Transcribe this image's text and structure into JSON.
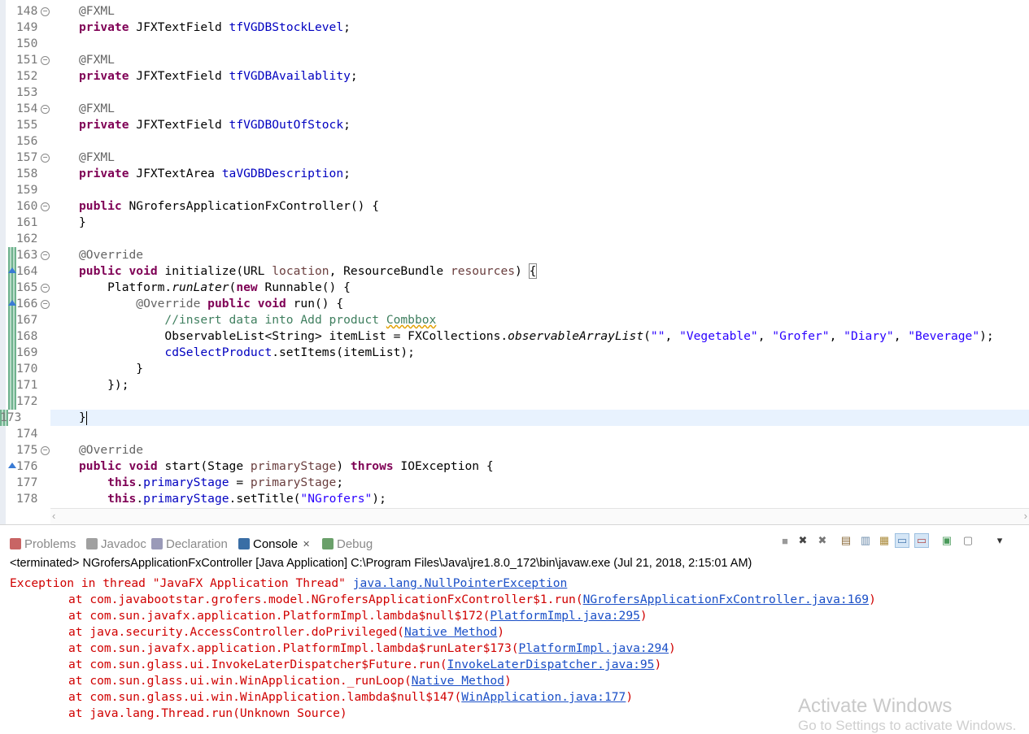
{
  "editor": {
    "lines": [
      {
        "num": "148",
        "fold": true,
        "seg": [
          {
            "t": "@FXML",
            "c": "ann"
          }
        ]
      },
      {
        "num": "149",
        "seg": [
          {
            "t": "private",
            "c": "kw"
          },
          {
            "t": " JFXTextField "
          },
          {
            "t": "tfVGDBStockLevel",
            "c": "fld"
          },
          {
            "t": ";"
          }
        ]
      },
      {
        "num": "150",
        "seg": []
      },
      {
        "num": "151",
        "fold": true,
        "seg": [
          {
            "t": "@FXML",
            "c": "ann"
          }
        ]
      },
      {
        "num": "152",
        "seg": [
          {
            "t": "private",
            "c": "kw"
          },
          {
            "t": " JFXTextField "
          },
          {
            "t": "tfVGDBAvailablity",
            "c": "fld"
          },
          {
            "t": ";"
          }
        ]
      },
      {
        "num": "153",
        "seg": []
      },
      {
        "num": "154",
        "fold": true,
        "seg": [
          {
            "t": "@FXML",
            "c": "ann"
          }
        ]
      },
      {
        "num": "155",
        "seg": [
          {
            "t": "private",
            "c": "kw"
          },
          {
            "t": " JFXTextField "
          },
          {
            "t": "tfVGDBOutOfStock",
            "c": "fld"
          },
          {
            "t": ";"
          }
        ]
      },
      {
        "num": "156",
        "seg": []
      },
      {
        "num": "157",
        "fold": true,
        "seg": [
          {
            "t": "@FXML",
            "c": "ann"
          }
        ]
      },
      {
        "num": "158",
        "seg": [
          {
            "t": "private",
            "c": "kw"
          },
          {
            "t": " JFXTextArea "
          },
          {
            "t": "taVGDBDescription",
            "c": "fld"
          },
          {
            "t": ";"
          }
        ]
      },
      {
        "num": "159",
        "seg": []
      },
      {
        "num": "160",
        "fold": true,
        "seg": [
          {
            "t": "public",
            "c": "kw"
          },
          {
            "t": " NGrofersApplicationFxController() {"
          }
        ]
      },
      {
        "num": "161",
        "seg": [
          {
            "t": "}"
          }
        ]
      },
      {
        "num": "162",
        "seg": []
      },
      {
        "num": "163",
        "fold": true,
        "mark": true,
        "seg": [
          {
            "t": "@Override",
            "c": "ann"
          }
        ]
      },
      {
        "num": "164",
        "arrow": true,
        "mark": true,
        "seg": [
          {
            "t": "public",
            "c": "kw"
          },
          {
            "t": " "
          },
          {
            "t": "void",
            "c": "kw"
          },
          {
            "t": " initialize(URL "
          },
          {
            "t": "location",
            "c": "par"
          },
          {
            "t": ", ResourceBundle "
          },
          {
            "t": "resources",
            "c": "par"
          },
          {
            "t": ") "
          },
          {
            "t": "{",
            "c": "brace-box"
          }
        ]
      },
      {
        "num": "165",
        "fold": true,
        "mark": true,
        "seg": [
          {
            "t": "    Platform."
          },
          {
            "t": "runLater",
            "c": "it"
          },
          {
            "t": "("
          },
          {
            "t": "new",
            "c": "kw"
          },
          {
            "t": " Runnable() {"
          }
        ]
      },
      {
        "num": "166",
        "fold": true,
        "arrow": true,
        "mark": true,
        "seg": [
          {
            "t": "        "
          },
          {
            "t": "@Override",
            "c": "ann"
          },
          {
            "t": " "
          },
          {
            "t": "public",
            "c": "kw"
          },
          {
            "t": " "
          },
          {
            "t": "void",
            "c": "kw"
          },
          {
            "t": " run() {"
          }
        ]
      },
      {
        "num": "167",
        "mark": true,
        "seg": [
          {
            "t": "            //insert data into Add product ",
            "c": "cmt"
          },
          {
            "t": "Combbox",
            "c": "cmt squig"
          }
        ]
      },
      {
        "num": "168",
        "mark": true,
        "seg": [
          {
            "t": "            ObservableList<String> itemList = FXCollections."
          },
          {
            "t": "observableArrayList",
            "c": "it"
          },
          {
            "t": "("
          },
          {
            "t": "\"\"",
            "c": "str"
          },
          {
            "t": ", "
          },
          {
            "t": "\"Vegetable\"",
            "c": "str"
          },
          {
            "t": ", "
          },
          {
            "t": "\"Grofer\"",
            "c": "str"
          },
          {
            "t": ", "
          },
          {
            "t": "\"Diary\"",
            "c": "str"
          },
          {
            "t": ", "
          },
          {
            "t": "\"Beverage\"",
            "c": "str"
          },
          {
            "t": ");"
          }
        ]
      },
      {
        "num": "169",
        "mark": true,
        "seg": [
          {
            "t": "            "
          },
          {
            "t": "cdSelectProduct",
            "c": "fld"
          },
          {
            "t": ".setItems(itemList);"
          }
        ]
      },
      {
        "num": "170",
        "mark": true,
        "seg": [
          {
            "t": "        }"
          }
        ]
      },
      {
        "num": "171",
        "mark": true,
        "seg": [
          {
            "t": "    });"
          }
        ]
      },
      {
        "num": "172",
        "mark": true,
        "seg": []
      },
      {
        "num": "173",
        "mark": true,
        "current": true,
        "seg": [
          {
            "t": "}"
          }
        ]
      },
      {
        "num": "174",
        "seg": []
      },
      {
        "num": "175",
        "fold": true,
        "seg": [
          {
            "t": "@Override",
            "c": "ann"
          }
        ]
      },
      {
        "num": "176",
        "arrow": true,
        "seg": [
          {
            "t": "public",
            "c": "kw"
          },
          {
            "t": " "
          },
          {
            "t": "void",
            "c": "kw"
          },
          {
            "t": " start(Stage "
          },
          {
            "t": "primaryStage",
            "c": "par"
          },
          {
            "t": ") "
          },
          {
            "t": "throws",
            "c": "kw"
          },
          {
            "t": " IOException {"
          }
        ]
      },
      {
        "num": "177",
        "seg": [
          {
            "t": "    "
          },
          {
            "t": "this",
            "c": "kw"
          },
          {
            "t": "."
          },
          {
            "t": "primaryStage",
            "c": "fld"
          },
          {
            "t": " = "
          },
          {
            "t": "primaryStage",
            "c": "par"
          },
          {
            "t": ";"
          }
        ]
      },
      {
        "num": "178",
        "seg": [
          {
            "t": "    "
          },
          {
            "t": "this",
            "c": "kw"
          },
          {
            "t": "."
          },
          {
            "t": "primaryStage",
            "c": "fld"
          },
          {
            "t": ".setTitle("
          },
          {
            "t": "\"NGrofers\"",
            "c": "str"
          },
          {
            "t": ");"
          }
        ]
      }
    ]
  },
  "tabs": [
    {
      "name": "tab-problems",
      "label": "Problems",
      "icon": "problems-icon",
      "color": "#c86464",
      "active": false
    },
    {
      "name": "tab-javadoc",
      "label": "Javadoc",
      "icon": "javadoc-icon",
      "color": "#a0a0a0",
      "active": false
    },
    {
      "name": "tab-declaration",
      "label": "Declaration",
      "icon": "declaration-icon",
      "color": "#9a9ab8",
      "active": false
    },
    {
      "name": "tab-console",
      "label": "Console",
      "icon": "console-icon",
      "color": "#3a6ea5",
      "active": true
    },
    {
      "name": "tab-debug",
      "label": "Debug",
      "icon": "debug-icon",
      "color": "#6aa06a",
      "active": false
    }
  ],
  "console": {
    "close_glyph": "✕",
    "header": "<terminated> NGrofersApplicationFxController [Java Application] C:\\Program Files\\Java\\jre1.8.0_172\\bin\\javaw.exe (Jul 21, 2018, 2:15:01 AM)",
    "lines": [
      {
        "indent": false,
        "seg": [
          {
            "t": "Exception in thread \"JavaFX Application Thread\" "
          },
          {
            "t": "java.lang.NullPointerException",
            "link": true
          }
        ]
      },
      {
        "indent": true,
        "seg": [
          {
            "t": "at com.javabootstar.grofers.model.NGrofersApplicationFxController$1.run("
          },
          {
            "t": "NGrofersApplicationFxController.java:169",
            "link": true
          },
          {
            "t": ")"
          }
        ]
      },
      {
        "indent": true,
        "seg": [
          {
            "t": "at com.sun.javafx.application.PlatformImpl.lambda$null$172("
          },
          {
            "t": "PlatformImpl.java:295",
            "link": true
          },
          {
            "t": ")"
          }
        ]
      },
      {
        "indent": true,
        "seg": [
          {
            "t": "at java.security.AccessController.doPrivileged("
          },
          {
            "t": "Native Method",
            "link": true
          },
          {
            "t": ")"
          }
        ]
      },
      {
        "indent": true,
        "seg": [
          {
            "t": "at com.sun.javafx.application.PlatformImpl.lambda$runLater$173("
          },
          {
            "t": "PlatformImpl.java:294",
            "link": true
          },
          {
            "t": ")"
          }
        ]
      },
      {
        "indent": true,
        "seg": [
          {
            "t": "at com.sun.glass.ui.InvokeLaterDispatcher$Future.run("
          },
          {
            "t": "InvokeLaterDispatcher.java:95",
            "link": true
          },
          {
            "t": ")"
          }
        ]
      },
      {
        "indent": true,
        "seg": [
          {
            "t": "at com.sun.glass.ui.win.WinApplication._runLoop("
          },
          {
            "t": "Native Method",
            "link": true
          },
          {
            "t": ")"
          }
        ]
      },
      {
        "indent": true,
        "seg": [
          {
            "t": "at com.sun.glass.ui.win.WinApplication.lambda$null$147("
          },
          {
            "t": "WinApplication.java:177",
            "link": true
          },
          {
            "t": ")"
          }
        ]
      },
      {
        "indent": true,
        "seg": [
          {
            "t": "at java.lang.Thread.run(Unknown Source)"
          }
        ]
      }
    ]
  },
  "toolbar": [
    "terminate-icon",
    "remove-launch-icon",
    "remove-all-icon",
    "scroll-lock-icon",
    "word-wrap-icon",
    "show-on-output-icon",
    "show-on-error-icon",
    "pin-console-icon",
    "display-console-icon",
    "open-console-icon",
    "menu-icon"
  ],
  "watermark": {
    "title": "Activate Windows",
    "subtitle": "Go to Settings to activate Windows."
  }
}
